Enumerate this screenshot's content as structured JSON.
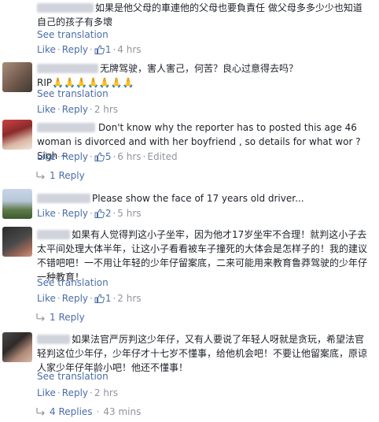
{
  "colors": {
    "link": "#4b6da8",
    "meta": "#90949c",
    "text": "#1d2129"
  },
  "common": {
    "see_translation": "See translation",
    "like": "Like",
    "reply": "Reply",
    "edited": "Edited",
    "sep": "·"
  },
  "comments": [
    {
      "text": "如果是他父母的車連他的父母也要負責任 做父母多多少少也知道自己的孩子有多壞",
      "like_count": "1",
      "time": "4 hrs"
    },
    {
      "text": "无牌驾驶，害人害己，何苦？良心过意得去吗？\nRIP🙏🙏🙏🙏🙏🙏🙏",
      "time": "2 hrs"
    },
    {
      "text": "Don't know why the reporter has to posted this age 46 woman is divorced and with her boyfriend , so details for what wor ? Sigh ~",
      "like_count": "5",
      "time": "6 hrs",
      "replies": "1 Reply"
    },
    {
      "text": "Please show the face of 17 years old driver...",
      "like_count": "2",
      "time": "5 hrs"
    },
    {
      "text": "如果有人觉得判这小子坐牢，因为他才17岁坐牢不合理！就判这小子去太平间处理大体半年，让这小子看看被车子撞死的大体会是怎样子的！我的建议不错吧吧！一不用让年轻的少年仔留案底，二来可能用来教育鲁莽驾驶的少年仔一种教育！",
      "like_count": "1",
      "time": "2 hrs",
      "replies": "1 Reply"
    },
    {
      "text": "如果法官严厉判这少年仔，又有人要说了年轻人呀就是贪玩，希望法官轻判这位少年仔，少年仔才十七岁不懂事，给他机会吧！不要让他留案底，原谅人家少年仔年龄小吧！他还不懂事！",
      "time": "2 hrs",
      "replies": "4 Replies",
      "replies_time": "43 mins"
    }
  ]
}
